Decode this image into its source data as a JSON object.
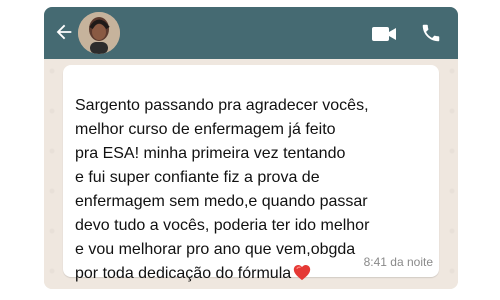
{
  "chat": {
    "colors": {
      "header": "#456a72",
      "background": "#efe7df",
      "bubble": "#ffffff",
      "text": "#111111",
      "time": "#8a8a8a"
    },
    "header_icons": {
      "back": "arrow-left-icon",
      "video": "video-camera-icon",
      "call": "phone-icon"
    },
    "message": {
      "text": "Sargento passando pra agradecer vocês,\nmelhor curso de enfermagem já feito\npra ESA! minha primeira vez tentando\ne fui super confiante fiz a prova de\nenfermagem sem medo,e quando passar\ndevo tudo a vocês, poderia ter ido melhor\ne vou melhorar pro ano que vem,obgda\npor toda dedicação do fórmula",
      "emoji": "heart",
      "time": "8:41 da noite"
    }
  }
}
